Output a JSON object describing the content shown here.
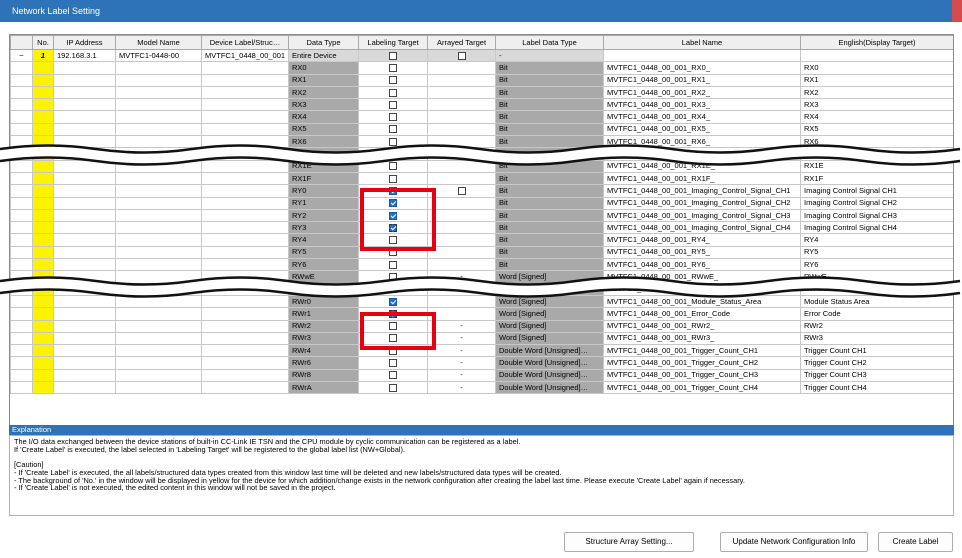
{
  "window": {
    "title": "Network Label Setting"
  },
  "headers": [
    "",
    "No.",
    "IP Address",
    "Model Name",
    "Device Label/Struc…",
    "Data Type",
    "Labeling Target",
    "Arrayed Target",
    "Label Data Type",
    "Label Name",
    "English(Display Target)"
  ],
  "device": {
    "expand": "−",
    "no": "1",
    "ip": "192.168.3.1",
    "model": "MVTFC1-0448-00",
    "device_label": "MVTFC1_0448_00_001"
  },
  "entire": {
    "dtype": "Entire Device",
    "ltype": "-"
  },
  "rows_a": [
    {
      "dtype": "RX0",
      "ltype": "Bit",
      "lname": "MVTFC1_0448_00_001_RX0_",
      "eng": "RX0"
    },
    {
      "dtype": "RX1",
      "ltype": "Bit",
      "lname": "MVTFC1_0448_00_001_RX1_",
      "eng": "RX1"
    },
    {
      "dtype": "RX2",
      "ltype": "Bit",
      "lname": "MVTFC1_0448_00_001_RX2_",
      "eng": "RX2"
    },
    {
      "dtype": "RX3",
      "ltype": "Bit",
      "lname": "MVTFC1_0448_00_001_RX3_",
      "eng": "RX3"
    },
    {
      "dtype": "RX4",
      "ltype": "Bit",
      "lname": "MVTFC1_0448_00_001_RX4_",
      "eng": "RX4"
    },
    {
      "dtype": "RX5",
      "ltype": "Bit",
      "lname": "MVTFC1_0448_00_001_RX5_",
      "eng": "RX5"
    },
    {
      "dtype": "RX6",
      "ltype": "Bit",
      "lname": "MVTFC1_0448_00_001_RX6_",
      "eng": "RX6"
    }
  ],
  "rows_b": [
    {
      "dtype": "RXD",
      "ltype": "Bit",
      "lname": "MVTFC1_0448_00_001_RXD_",
      "eng": "RXD",
      "arr": false
    },
    {
      "dtype": "RX1E",
      "ltype": "Bit",
      "lname": "MVTFC1_0448_00_001_RX1E_",
      "eng": "RX1E",
      "arr": false
    },
    {
      "dtype": "RX1F",
      "ltype": "Bit",
      "lname": "MVTFC1_0448_00_001_RX1F_",
      "eng": "RX1F",
      "arr": false
    },
    {
      "dtype": "RY0",
      "ltype": "Bit",
      "lname": "MVTFC1_0448_00_001_Imaging_Control_Signal_CH1",
      "eng": "Imaging Control Signal CH1",
      "checked": true,
      "arr": true
    },
    {
      "dtype": "RY1",
      "ltype": "Bit",
      "lname": "MVTFC1_0448_00_001_Imaging_Control_Signal_CH2",
      "eng": "Imaging Control Signal CH2",
      "checked": true
    },
    {
      "dtype": "RY2",
      "ltype": "Bit",
      "lname": "MVTFC1_0448_00_001_Imaging_Control_Signal_CH3",
      "eng": "Imaging Control Signal CH3",
      "checked": true
    },
    {
      "dtype": "RY3",
      "ltype": "Bit",
      "lname": "MVTFC1_0448_00_001_Imaging_Control_Signal_CH4",
      "eng": "Imaging Control Signal CH4",
      "checked": true,
      "sel": true
    },
    {
      "dtype": "RY4",
      "ltype": "Bit",
      "lname": "MVTFC1_0448_00_001_RY4_",
      "eng": "RY4"
    },
    {
      "dtype": "RY5",
      "ltype": "Bit",
      "lname": "MVTFC1_0448_00_001_RY5_",
      "eng": "RY5"
    },
    {
      "dtype": "RY6",
      "ltype": "Bit",
      "lname": "MVTFC1_0448_00_001_RY6_",
      "eng": "RY6"
    }
  ],
  "rows_c": [
    {
      "dtype": "RWwE",
      "dash": "-",
      "ltype": "Word [Signed]",
      "lname": "MVTFC1_0448_00_001_RWwE_",
      "eng": "RWwE"
    },
    {
      "dtype": "RWwF",
      "dash": "-",
      "ltype": "Word [Signed]",
      "lname": "MVTFC1_0448_00_001_RWwF_",
      "eng": "RWwF"
    },
    {
      "dtype": "RWr0",
      "dash": "",
      "ltype": "Word [Signed]",
      "lname": "MVTFC1_0448_00_001_Module_Status_Area",
      "eng": "Module Status Area",
      "checked": true
    },
    {
      "dtype": "RWr1",
      "dash": "",
      "ltype": "Word [Signed]",
      "lname": "MVTFC1_0448_00_001_Error_Code",
      "eng": "Error Code",
      "checked": true,
      "sel": true
    },
    {
      "dtype": "RWr2",
      "dash": "-",
      "ltype": "Word [Signed]",
      "lname": "MVTFC1_0448_00_001_RWr2_",
      "eng": "RWr2"
    },
    {
      "dtype": "RWr3",
      "dash": "-",
      "ltype": "Word [Signed]",
      "lname": "MVTFC1_0448_00_001_RWr3_",
      "eng": "RWr3"
    },
    {
      "dtype": "RWr4",
      "dash": "-",
      "ltype": "Double Word [Unsigned]…",
      "lname": "MVTFC1_0448_00_001_Trigger_Count_CH1",
      "eng": "Trigger Count CH1"
    },
    {
      "dtype": "RWr6",
      "dash": "-",
      "ltype": "Double Word [Unsigned]…",
      "lname": "MVTFC1_0448_00_001_Trigger_Count_CH2",
      "eng": "Trigger Count CH2"
    },
    {
      "dtype": "RWr8",
      "dash": "-",
      "ltype": "Double Word [Unsigned]…",
      "lname": "MVTFC1_0448_00_001_Trigger_Count_CH3",
      "eng": "Trigger Count CH3"
    },
    {
      "dtype": "RWrA",
      "dash": "-",
      "ltype": "Double Word [Unsigned]…",
      "lname": "MVTFC1_0448_00_001_Trigger_Count_CH4",
      "eng": "Trigger Count CH4"
    }
  ],
  "explanation": {
    "title": "Explanation",
    "lines": [
      "The I/O data exchanged between the device stations of built-in CC-Link IE TSN and the CPU module by cyclic communication can be registered as a label.",
      "If 'Create Label' is executed, the label selected in 'Labeling Target' will be registered to the global label list (NW+Global).",
      "",
      "[Caution]",
      "- If 'Create Label' is executed, the all labels/structured data types created from this window last time will be deleted and new labels/structured data types will be created.",
      "- The background of 'No.' in the window will be displayed in yellow for the device for which addition/change exists in the network configuration after creating the label last time. Please execute 'Create Label' again if necessary.",
      "- If 'Create Label' is not executed, the edited content in this window will not be saved in the project."
    ]
  },
  "buttons": {
    "structure": "Structure Array Setting...",
    "update": "Update Network Configuration Info",
    "create": "Create Label"
  },
  "colors": {
    "title_bar": "#2e73b7",
    "highlight": "#e60012",
    "no_changed": "#fdf300",
    "checkbox_on": "#1f6fd1"
  }
}
